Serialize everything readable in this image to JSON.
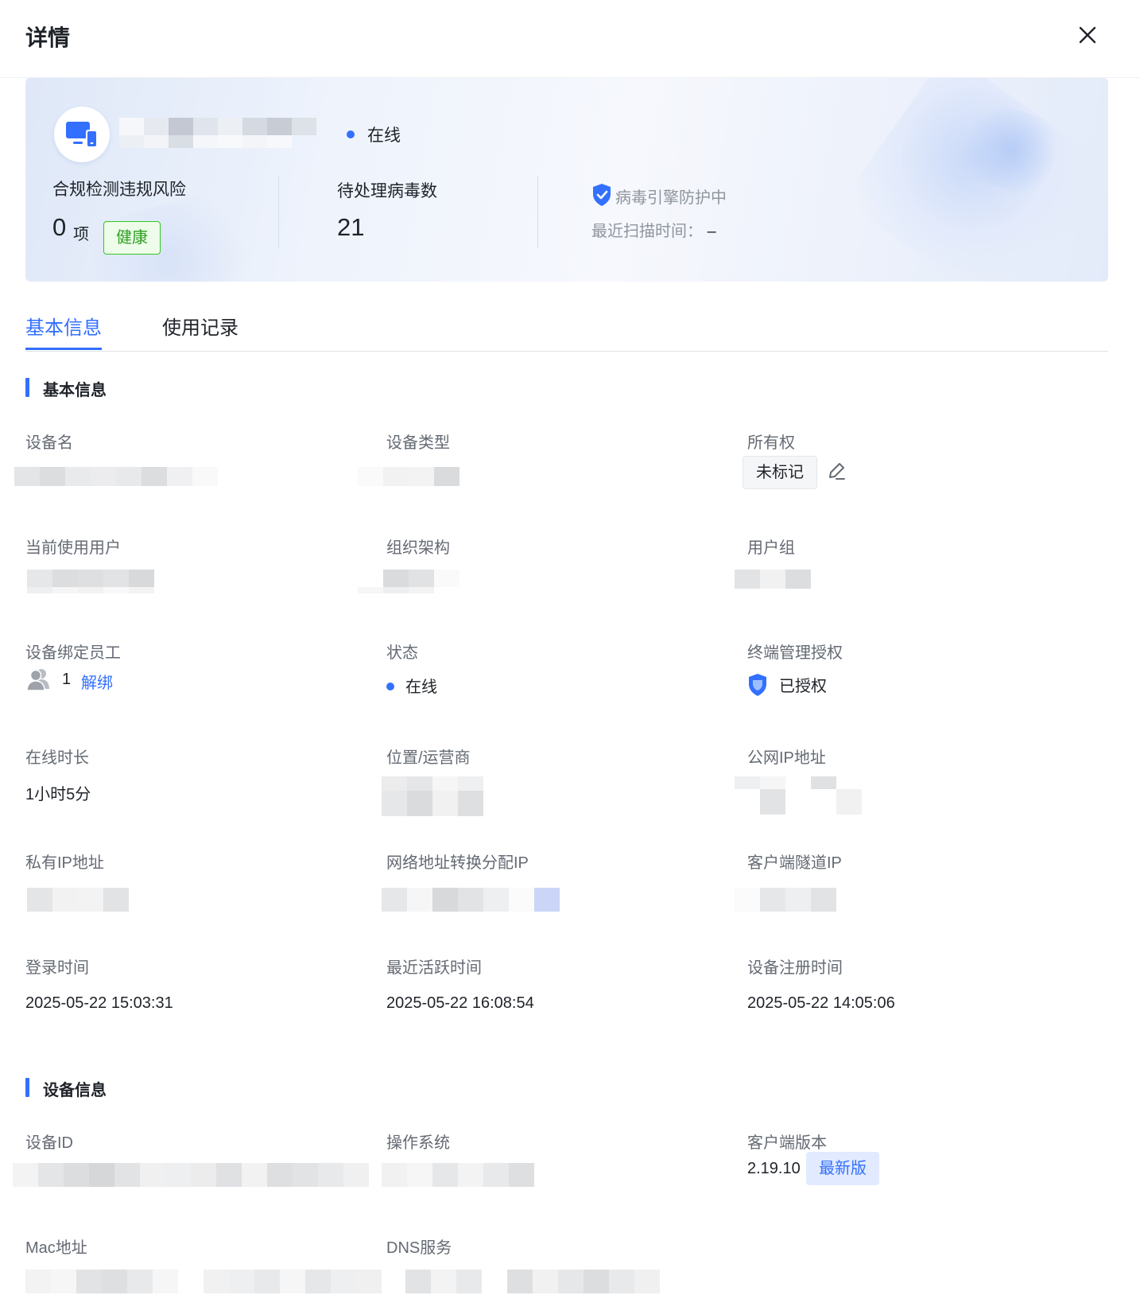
{
  "header": {
    "title": "详情",
    "close_icon": "close-icon"
  },
  "hero": {
    "device_icon": "monitor-phone-icon",
    "status": "在线",
    "compliance": {
      "label": "合规检测违规风险",
      "count": "0",
      "unit": "项",
      "tag": "健康"
    },
    "virus": {
      "label": "待处理病毒数",
      "count": "21"
    },
    "engine": {
      "icon": "shield-check-icon",
      "label": "病毒引擎防护中",
      "scan_label": "最近扫描时间：",
      "scan_value": "–"
    }
  },
  "tabs": [
    {
      "label": "基本信息",
      "active": true
    },
    {
      "label": "使用记录",
      "active": false
    }
  ],
  "basic": {
    "title": "基本信息",
    "device_name": {
      "label": "设备名"
    },
    "device_type": {
      "label": "设备类型"
    },
    "ownership": {
      "label": "所有权",
      "value": "未标记",
      "edit_icon": "edit-icon"
    },
    "current_user": {
      "label": "当前使用用户"
    },
    "org": {
      "label": "组织架构"
    },
    "user_group": {
      "label": "用户组"
    },
    "bound_staff": {
      "label": "设备绑定员工",
      "icon": "users-icon",
      "count": "1",
      "action": "解绑"
    },
    "status": {
      "label": "状态",
      "value": "在线"
    },
    "auth": {
      "label": "终端管理授权",
      "icon": "shield-icon",
      "value": "已授权"
    },
    "online_duration": {
      "label": "在线时长",
      "value": "1小时5分"
    },
    "location": {
      "label": "位置/运营商"
    },
    "public_ip": {
      "label": "公网IP地址"
    },
    "private_ip": {
      "label": "私有IP地址"
    },
    "nat_ip": {
      "label": "网络地址转换分配IP"
    },
    "tunnel_ip": {
      "label": "客户端隧道IP"
    },
    "login_time": {
      "label": "登录时间",
      "value": "2025-05-22 15:03:31"
    },
    "last_active": {
      "label": "最近活跃时间",
      "value": "2025-05-22 16:08:54"
    },
    "register_time": {
      "label": "设备注册时间",
      "value": "2025-05-22 14:05:06"
    }
  },
  "device": {
    "title": "设备信息",
    "device_id": {
      "label": "设备ID"
    },
    "os": {
      "label": "操作系统"
    },
    "client_version": {
      "label": "客户端版本",
      "value": "2.19.10",
      "tag": "最新版"
    },
    "mac": {
      "label": "Mac地址"
    },
    "dns": {
      "label": "DNS服务"
    }
  },
  "colors": {
    "accent": "#3370ff",
    "health": "#2ea121",
    "label": "#646a73",
    "text": "#1f2329"
  }
}
